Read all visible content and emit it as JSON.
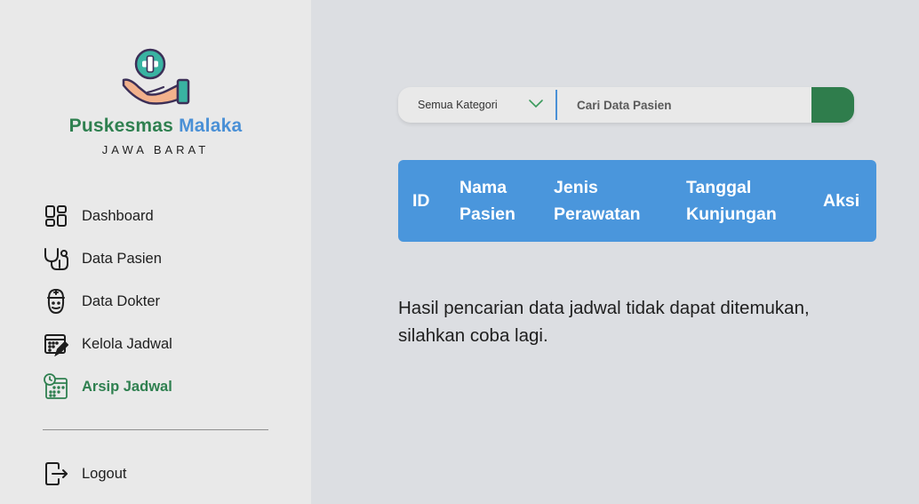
{
  "brand": {
    "name_part1": "Puskesmas",
    "name_part2": "Malaka",
    "region": "JAWA BARAT"
  },
  "colors": {
    "brand_green": "#2f8050",
    "brand_blue": "#4a90d6",
    "table_header": "#4a96dc",
    "search_button": "#2f7d4c"
  },
  "sidebar": {
    "items": [
      {
        "label": "Dashboard",
        "icon": "dashboard-icon"
      },
      {
        "label": "Data Pasien",
        "icon": "stethoscope-icon"
      },
      {
        "label": "Data Dokter",
        "icon": "doctor-icon"
      },
      {
        "label": "Kelola Jadwal",
        "icon": "calendar-edit-icon"
      },
      {
        "label": "Arsip Jadwal",
        "icon": "schedule-archive-icon",
        "active": true
      }
    ],
    "logout": {
      "label": "Logout",
      "icon": "logout-icon"
    }
  },
  "search": {
    "category_selected": "Semua Kategori",
    "placeholder": "Cari Data Pasien",
    "value": ""
  },
  "table": {
    "headers": [
      {
        "line1": "ID",
        "line2": ""
      },
      {
        "line1": "Nama",
        "line2": "Pasien"
      },
      {
        "line1": "Jenis",
        "line2": "Perawatan"
      },
      {
        "line1": "Tanggal",
        "line2": "Kunjungan"
      },
      {
        "line1": "Aksi",
        "line2": ""
      }
    ]
  },
  "message": {
    "line1": "Hasil pencarian data jadwal tidak dapat ditemukan,",
    "line2": "silahkan coba lagi."
  }
}
